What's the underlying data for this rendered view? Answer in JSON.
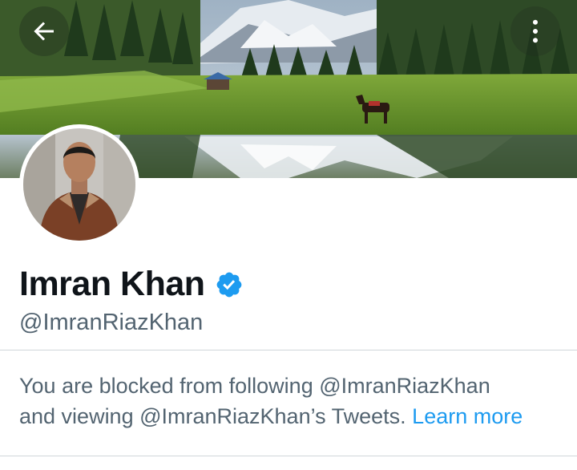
{
  "profile": {
    "display_name": "Imran Khan",
    "handle": "@ImranRiazKhan",
    "verified": true
  },
  "header": {
    "back_icon": "back-arrow-icon",
    "more_icon": "more-vertical-icon"
  },
  "blocked_notice": {
    "line1": "You are blocked from following @ImranRiazKhan",
    "line2": "and viewing @ImranRiazKhan’s Tweets.",
    "link_label": "Learn more"
  },
  "colors": {
    "link": "#1d9bf0",
    "verified": "#1d9bf0",
    "secondary_text": "#536471",
    "primary_text": "#0f1419"
  }
}
